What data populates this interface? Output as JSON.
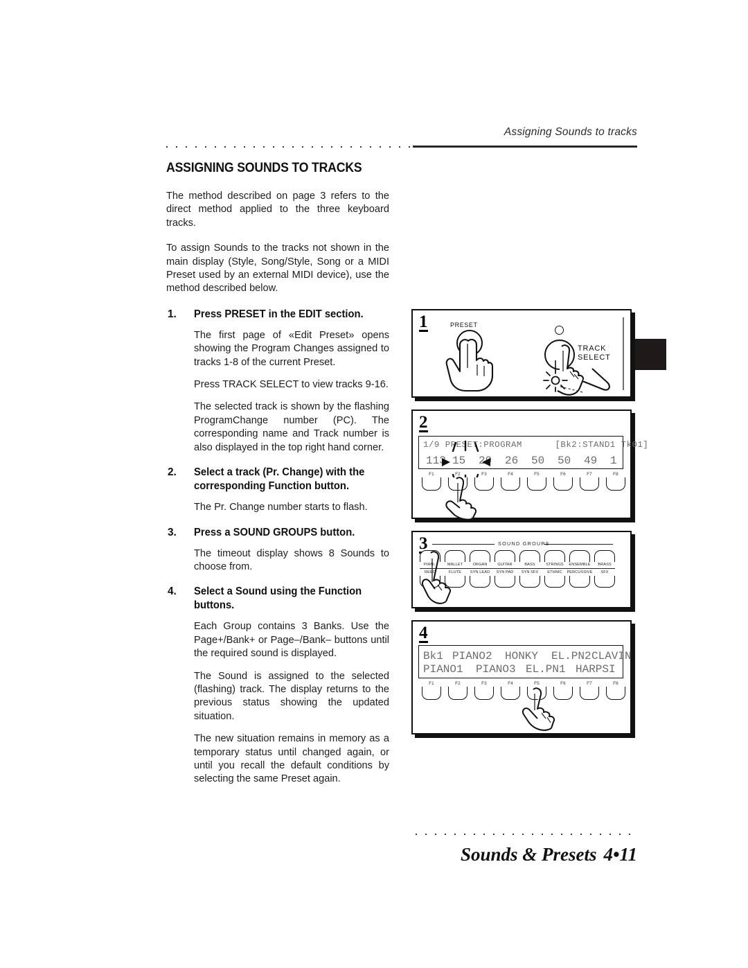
{
  "running_head": "Assigning Sounds to tracks",
  "section_title": "ASSIGNING SOUNDS TO TRACKS",
  "intro": {
    "para1": "The method described on page 3 refers to the direct method applied to the three keyboard tracks.",
    "para2": "To assign Sounds to the tracks not shown in the main display (Style, Song/Style, Song or a MIDI Preset used by an external MIDI device), use the method described below."
  },
  "steps": [
    {
      "num": "1.",
      "title": "Press PRESET in the EDIT section.",
      "paragraphs": [
        "The first page of «Edit Preset» opens showing the Program Changes assigned to tracks 1-8 of the current Preset.",
        "Press TRACK SELECT to view tracks 9-16.",
        "The selected track is shown by the flashing ProgramChange number (PC).  The corresponding name and Track number is also displayed in the top right hand corner."
      ]
    },
    {
      "num": "2.",
      "title": "Select a track (Pr. Change) with the corresponding Function button.",
      "paragraphs": [
        "The Pr. Change number starts to flash."
      ]
    },
    {
      "num": "3.",
      "title": "Press a SOUND GROUPS button.",
      "paragraphs": [
        "The timeout display shows 8 Sounds to choose from."
      ]
    },
    {
      "num": "4.",
      "title": "Select a Sound using the Function buttons.",
      "paragraphs": [
        "Each Group contains 3 Banks.  Use the Page+/Bank+ or Page–/Bank– buttons until the required sound is displayed.",
        "The Sound is assigned to the selected (flashing) track.  The display returns to the previous status showing the updated situation.",
        "The new situation remains in memory as a temporary status until changed again, or until you recall the default conditions by selecting the same Preset again."
      ]
    }
  ],
  "figures": {
    "fig1": {
      "number": "1",
      "preset_label": "PRESET",
      "track_select_line1": "TRACK",
      "track_select_line2": "SELECT"
    },
    "fig2": {
      "number": "2",
      "lcd_line1": "1/9 PRESET:PROGRAM      [Bk2:STAND1 Tk01]",
      "lcd_values": [
        "113",
        "15",
        "29",
        "26",
        "50",
        "50",
        "49",
        "1"
      ],
      "function_labels": [
        "F1",
        "F2",
        "F3",
        "F4",
        "F5",
        "F6",
        "F7",
        "F8"
      ],
      "pressed_button": "F2"
    },
    "fig3": {
      "number": "3",
      "group_title": "SOUND GROUPS",
      "groups_top": [
        "PIANO",
        "MALLET",
        "ORGAN",
        "GUITAR",
        "BASS",
        "STRINGS",
        "ENSEMBLE",
        "BRASS"
      ],
      "groups_bottom": [
        "REED",
        "FLUTE",
        "SYN LEAD",
        "SYN PAD",
        "SYN SFX",
        "ETHNIC",
        "PERCUSSIVE",
        "SFX"
      ],
      "pressed_button": "PIANO"
    },
    "fig4": {
      "number": "4",
      "lcd_row_top": [
        "Bk1",
        "PIANO2",
        "HONKY",
        "EL.PN2",
        "CLAVIN"
      ],
      "lcd_row_bottom": [
        "PIANO1",
        "PIANO3",
        "EL.PN1",
        "HARPSI"
      ],
      "function_labels": [
        "F1",
        "F2",
        "F3",
        "F4",
        "F5",
        "F6",
        "F7",
        "F8"
      ],
      "pressed_button": "F5"
    }
  },
  "footer": {
    "title": "Sounds & Presets",
    "page": "4•11"
  }
}
